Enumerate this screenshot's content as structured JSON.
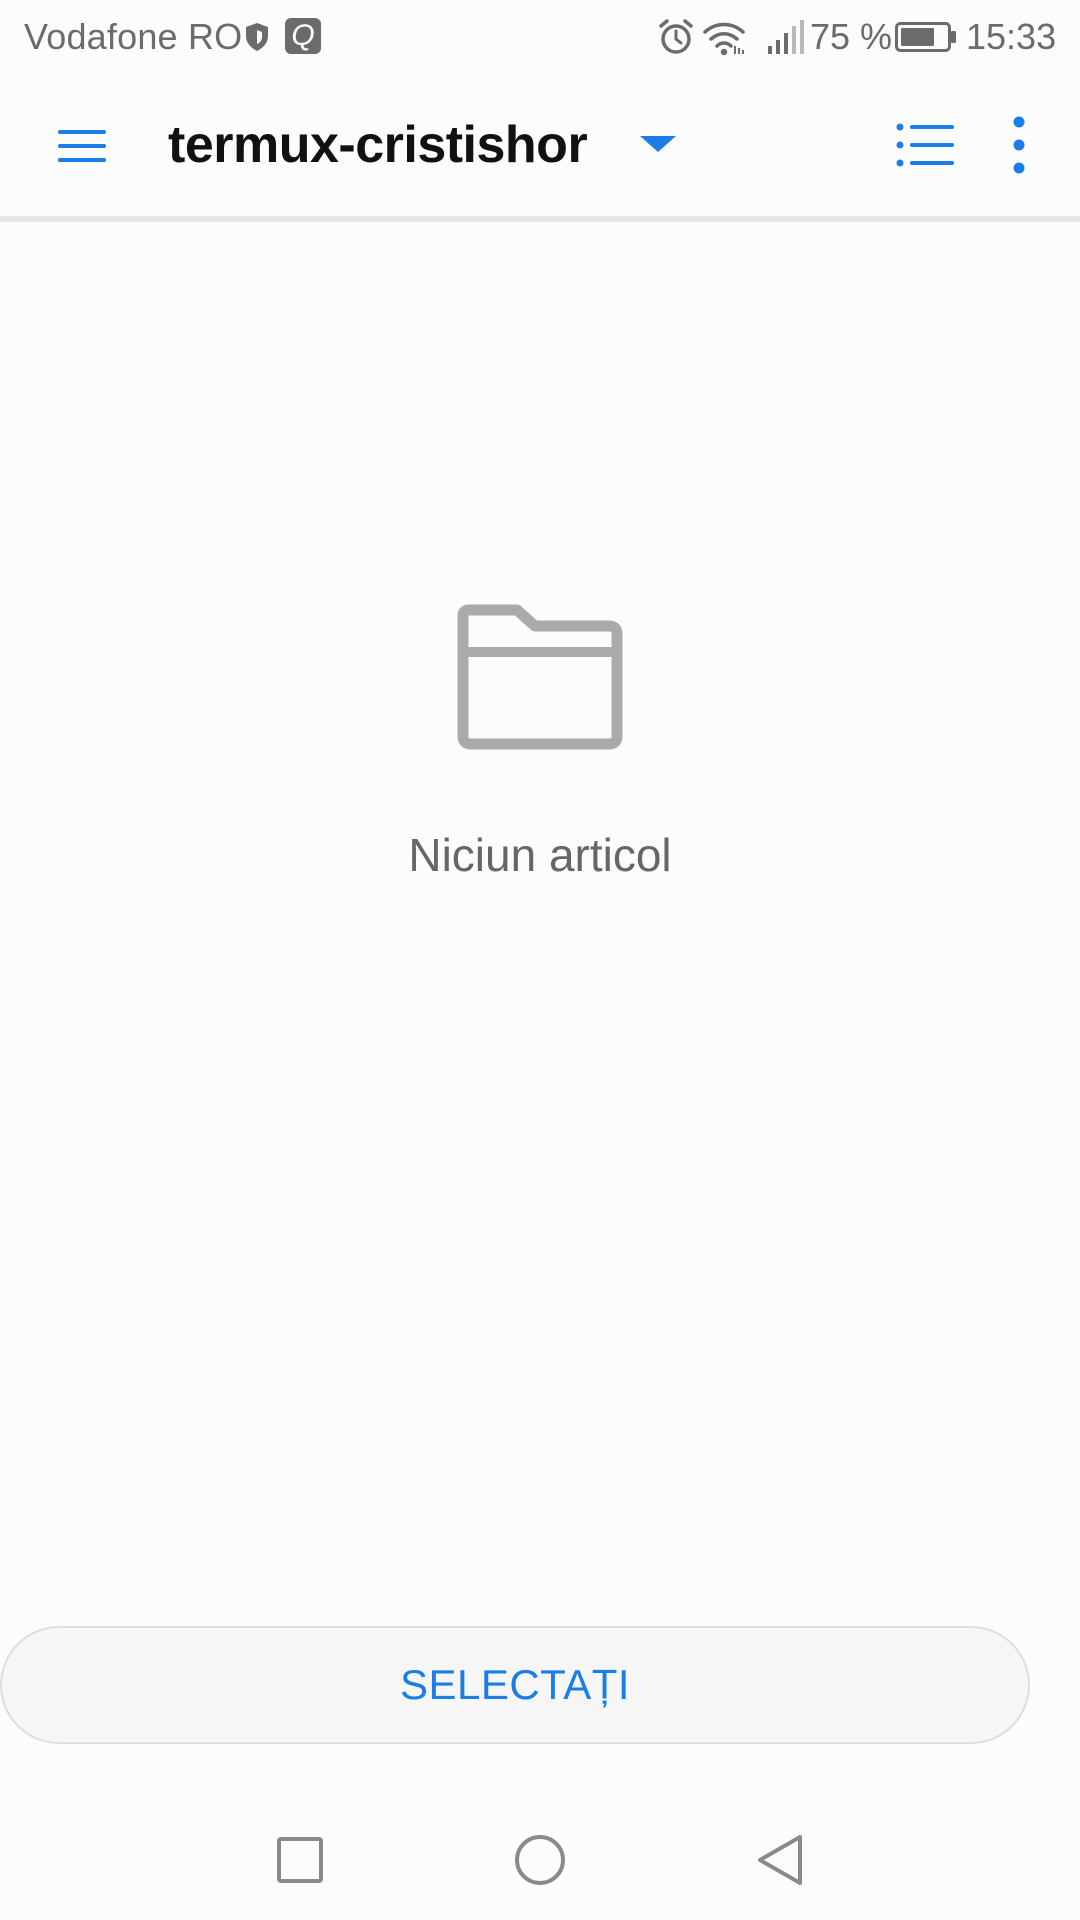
{
  "status_bar": {
    "carrier": "Vodafone RO",
    "app_badge": "Q",
    "battery_percent": "75 %",
    "battery_level": 0.75,
    "time": "15:33",
    "icons": [
      "shield-icon",
      "app-badge-icon",
      "alarm-icon",
      "wifi-icon",
      "signal-icon",
      "battery-icon"
    ]
  },
  "app_bar": {
    "title": "termux-cristishor",
    "icons": [
      "menu-icon",
      "dropdown-arrow-icon",
      "list-view-icon",
      "more-vert-icon"
    ]
  },
  "empty_state": {
    "icon": "folder-icon",
    "message": "Niciun articol"
  },
  "actions": {
    "select_label": "SELECTAȚI"
  },
  "nav_bar": {
    "icons": [
      "recents-icon",
      "home-icon",
      "back-icon"
    ]
  },
  "colors": {
    "accent": "#1a7ee6",
    "background": "#fcfcfc",
    "muted_icon": "#aaaaaa",
    "text_secondary": "#666666"
  }
}
